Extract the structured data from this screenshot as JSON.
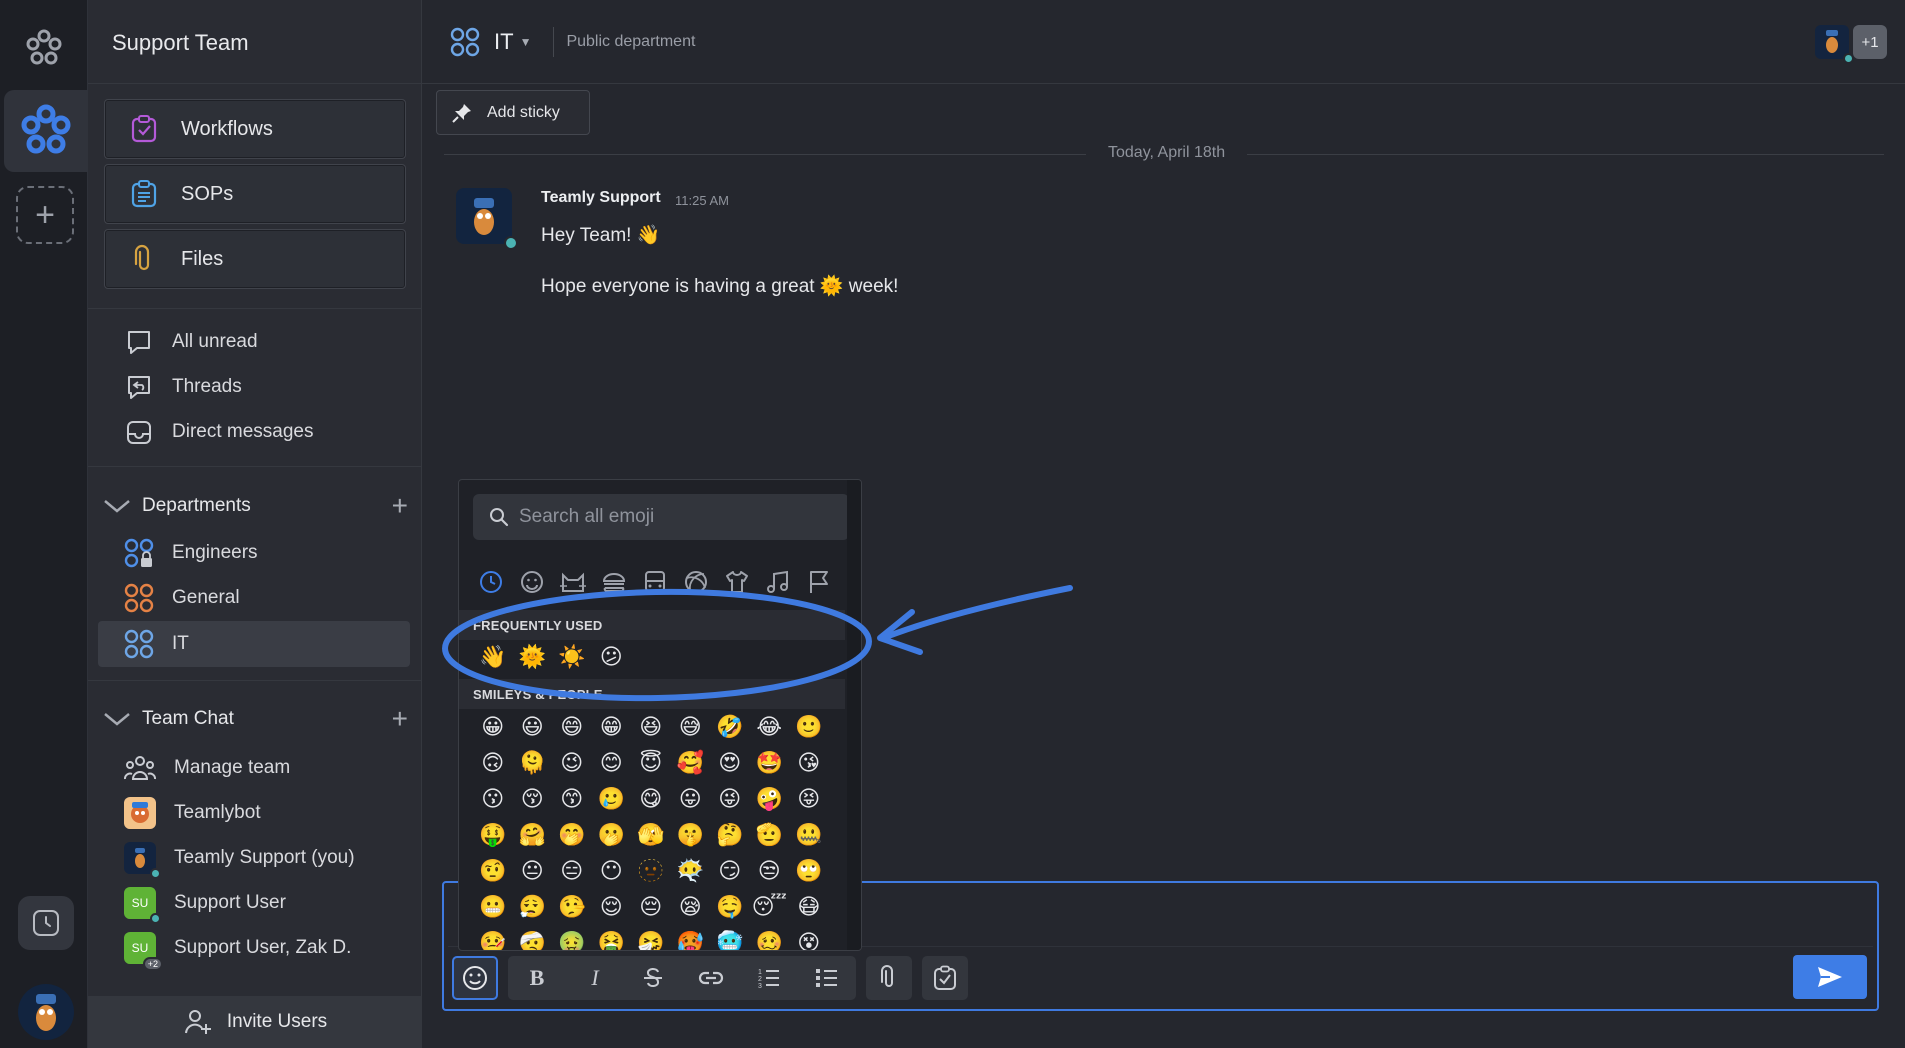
{
  "team": {
    "name": "Support Team"
  },
  "sidebar": {
    "tools": [
      {
        "label": "Workflows",
        "icon": "clipboard-check-icon",
        "color": "#b45ad8"
      },
      {
        "label": "SOPs",
        "icon": "clipboard-list-icon",
        "color": "#4fa3e6"
      },
      {
        "label": "Files",
        "icon": "paperclip-icon",
        "color": "#d7a341"
      }
    ],
    "nav": [
      {
        "label": "All unread",
        "icon": "chat-bubble-icon"
      },
      {
        "label": "Threads",
        "icon": "reply-bubble-icon"
      },
      {
        "label": "Direct messages",
        "icon": "inbox-icon"
      }
    ],
    "departments": {
      "title": "Departments",
      "items": [
        {
          "label": "Engineers",
          "color": "#4f8fe8"
        },
        {
          "label": "General",
          "color": "#e58245"
        },
        {
          "label": "IT",
          "color": "#6ea6e6"
        }
      ]
    },
    "team_chat": {
      "title": "Team Chat",
      "items": [
        {
          "label": "Manage team"
        },
        {
          "label": "Teamlybot"
        },
        {
          "label": "Teamly Support (you)"
        },
        {
          "label": "Support User",
          "initials": "SU"
        },
        {
          "label": "Support User, Zak D.",
          "initials": "SU",
          "badge": "+2"
        }
      ]
    },
    "invite_label": "Invite Users"
  },
  "channel": {
    "name": "IT",
    "description": "Public department",
    "members_extra": "+1"
  },
  "toolbar": {
    "add_sticky": "Add sticky"
  },
  "chat": {
    "date_label": "Today, April 18th",
    "messages": [
      {
        "author": "Teamly Support",
        "time": "11:25 AM",
        "line1": "Hey Team! 👋",
        "line2": "Hope everyone is having a great 🌞 week!"
      }
    ]
  },
  "emoji_picker": {
    "search_placeholder": "Search all emoji",
    "categories": [
      "recent-icon",
      "smiley-icon",
      "animal-icon",
      "food-icon",
      "travel-icon",
      "activity-icon",
      "objects-icon",
      "music-icon",
      "flag-icon"
    ],
    "frequently_used_title": "FREQUENTLY USED",
    "frequently_used": [
      "👋",
      "🌞",
      "☀️",
      "😕"
    ],
    "smileys_title": "SMILEYS & PEOPLE",
    "smileys_rows": [
      [
        "😀",
        "😃",
        "😄",
        "😁",
        "😆",
        "😅",
        "🤣",
        "😂",
        "🙂"
      ],
      [
        "🙃",
        "🫠",
        "😉",
        "😊",
        "😇",
        "🥰",
        "😍",
        "🤩",
        "😘"
      ],
      [
        "😗",
        "😚",
        "😙",
        "🥲",
        "😋",
        "😛",
        "😜",
        "🤪",
        "😝"
      ],
      [
        "🤑",
        "🤗",
        "🤭",
        "🫢",
        "🫣",
        "🤫",
        "🤔",
        "🫡",
        "🤐"
      ],
      [
        "🤨",
        "😐",
        "😑",
        "😶",
        "🫥",
        "😶‍🌫️",
        "😏",
        "😒",
        "🙄"
      ],
      [
        "😬",
        "😮‍💨",
        "🤥",
        "😌",
        "😔",
        "😪",
        "🤤",
        "😴",
        "😷"
      ],
      [
        "🤒",
        "🤕",
        "🤢",
        "🤮",
        "🤧",
        "🥵",
        "🥶",
        "🥴",
        "😵"
      ]
    ]
  },
  "composer": {
    "tools": [
      "smiley-icon",
      "bold-icon",
      "italic-icon",
      "strikethrough-icon",
      "link-icon",
      "ordered-list-icon",
      "bullet-list-icon",
      "paperclip-icon",
      "checklist-icon",
      "send-icon"
    ]
  },
  "colors": {
    "accent": "#3e7de6",
    "annotation": "#3f7ae0"
  }
}
